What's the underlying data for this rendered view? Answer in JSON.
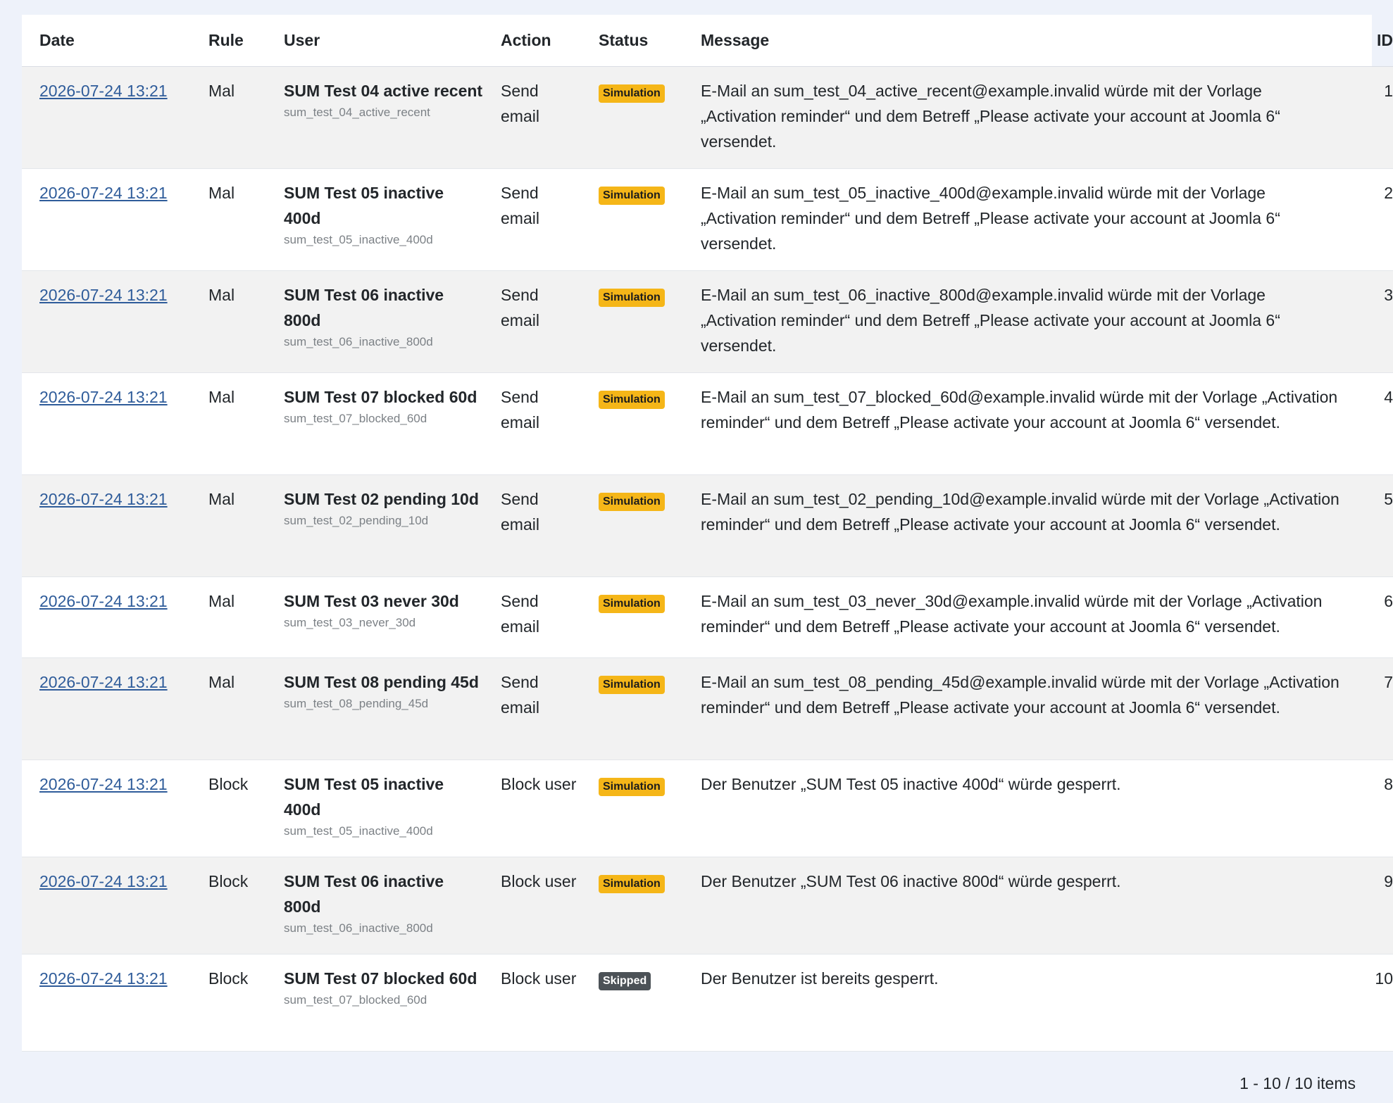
{
  "columns": {
    "date": "Date",
    "rule": "Rule",
    "user": "User",
    "action": "Action",
    "status": "Status",
    "message": "Message",
    "id": "ID"
  },
  "rows": [
    {
      "date": "2026-07-24 13:21",
      "rule": "Mal",
      "user_name": "SUM Test 04 active recent",
      "user_login": "sum_test_04_active_recent",
      "action": "Send email",
      "status": "Simulation",
      "message": "E-Mail an sum_test_04_active_recent@example.invalid würde mit der Vorlage „Activation reminder“ und dem Betreff „Please activate your account at Joomla 6“ versendet.",
      "id": "1"
    },
    {
      "date": "2026-07-24 13:21",
      "rule": "Mal",
      "user_name": "SUM Test 05 inactive 400d",
      "user_login": "sum_test_05_inactive_400d",
      "action": "Send email",
      "status": "Simulation",
      "message": "E-Mail an sum_test_05_inactive_400d@example.invalid würde mit der Vorlage „Activation reminder“ und dem Betreff „Please activate your account at Joomla 6“ versendet.",
      "id": "2"
    },
    {
      "date": "2026-07-24 13:21",
      "rule": "Mal",
      "user_name": "SUM Test 06 inactive 800d",
      "user_login": "sum_test_06_inactive_800d",
      "action": "Send email",
      "status": "Simulation",
      "message": "E-Mail an sum_test_06_inactive_800d@example.invalid würde mit der Vorlage „Activation reminder“ und dem Betreff „Please activate your account at Joomla 6“ versendet.",
      "id": "3"
    },
    {
      "date": "2026-07-24 13:21",
      "rule": "Mal",
      "user_name": "SUM Test 07 blocked 60d",
      "user_login": "sum_test_07_blocked_60d",
      "action": "Send email",
      "status": "Simulation",
      "message": "E-Mail an sum_test_07_blocked_60d@example.invalid würde mit der Vorlage „Activation reminder“ und dem Betreff „Please activate your account at Joomla 6“ versendet.",
      "id": "4"
    },
    {
      "date": "2026-07-24 13:21",
      "rule": "Mal",
      "user_name": "SUM Test 02 pending 10d",
      "user_login": "sum_test_02_pending_10d",
      "action": "Send email",
      "status": "Simulation",
      "message": "E-Mail an sum_test_02_pending_10d@example.invalid würde mit der Vorlage „Activation reminder“ und dem Betreff „Please activate your account at Joomla 6“ versendet.",
      "id": "5"
    },
    {
      "date": "2026-07-24 13:21",
      "rule": "Mal",
      "user_name": "SUM Test 03 never 30d",
      "user_login": "sum_test_03_never_30d",
      "action": "Send email",
      "status": "Simulation",
      "message": "E-Mail an sum_test_03_never_30d@example.invalid würde mit der Vorlage „Activation reminder“ und dem Betreff „Please activate your account at Joomla 6“ versendet.",
      "id": "6"
    },
    {
      "date": "2026-07-24 13:21",
      "rule": "Mal",
      "user_name": "SUM Test 08 pending 45d",
      "user_login": "sum_test_08_pending_45d",
      "action": "Send email",
      "status": "Simulation",
      "message": "E-Mail an sum_test_08_pending_45d@example.invalid würde mit der Vorlage „Activation reminder“ und dem Betreff „Please activate your account at Joomla 6“ versendet.",
      "id": "7"
    },
    {
      "date": "2026-07-24 13:21",
      "rule": "Block",
      "user_name": "SUM Test 05 inactive 400d",
      "user_login": "sum_test_05_inactive_400d",
      "action": "Block user",
      "status": "Simulation",
      "message": "Der Benutzer „SUM Test 05 inactive 400d“ würde gesperrt.",
      "id": "8"
    },
    {
      "date": "2026-07-24 13:21",
      "rule": "Block",
      "user_name": "SUM Test 06 inactive 800d",
      "user_login": "sum_test_06_inactive_800d",
      "action": "Block user",
      "status": "Simulation",
      "message": "Der Benutzer „SUM Test 06 inactive 800d“ würde gesperrt.",
      "id": "9"
    },
    {
      "date": "2026-07-24 13:21",
      "rule": "Block",
      "user_name": "SUM Test 07 blocked 60d",
      "user_login": "sum_test_07_blocked_60d",
      "action": "Block user",
      "status": "Skipped",
      "message": "Der Benutzer ist bereits gesperrt.",
      "id": "10"
    }
  ],
  "status_colors": {
    "Simulation": "#f5b618",
    "Skipped": "#4c5257"
  },
  "pagination": {
    "summary": "1 - 10 / 10 items"
  }
}
